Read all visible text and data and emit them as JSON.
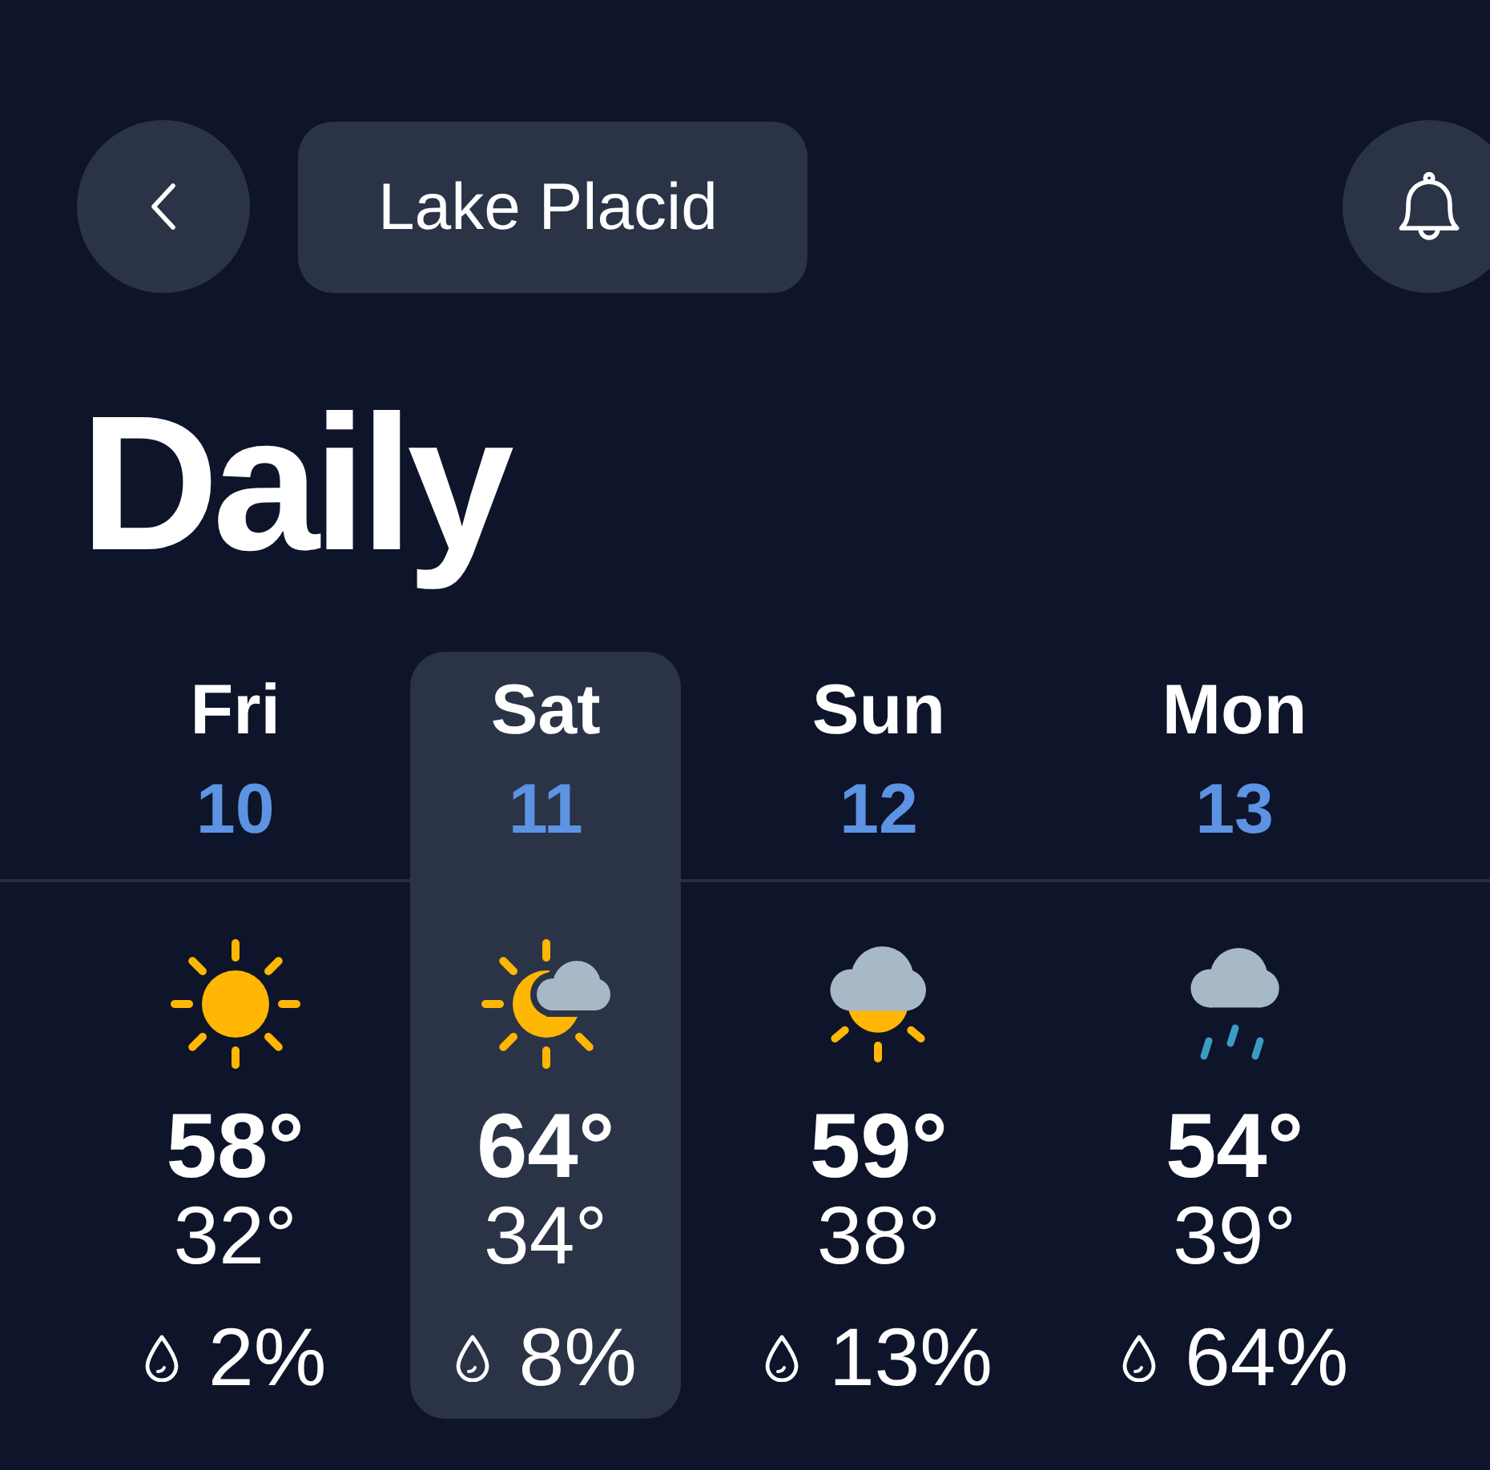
{
  "header": {
    "location": "Lake Placid"
  },
  "title": "Daily",
  "days": [
    {
      "day": "Fri",
      "date": "10",
      "kind": "sun",
      "high": "58°",
      "low": "32°",
      "precipitation": "2%",
      "selected": false
    },
    {
      "day": "Sat",
      "date": "11",
      "kind": "sun-cloud",
      "high": "64°",
      "low": "34°",
      "precipitation": "8%",
      "selected": true
    },
    {
      "day": "Sun",
      "date": "12",
      "kind": "cloud-sun",
      "high": "59°",
      "low": "38°",
      "precipitation": "13%",
      "selected": false
    },
    {
      "day": "Mon",
      "date": "13",
      "kind": "rain",
      "high": "54°",
      "low": "39°",
      "precipitation": "64%",
      "selected": false
    }
  ]
}
